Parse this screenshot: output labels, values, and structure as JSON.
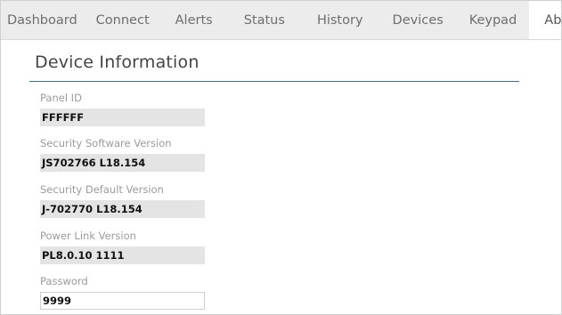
{
  "tabs": [
    {
      "label": "Dashboard",
      "active": false
    },
    {
      "label": "Connect",
      "active": false
    },
    {
      "label": "Alerts",
      "active": false
    },
    {
      "label": "Status",
      "active": false
    },
    {
      "label": "History",
      "active": false
    },
    {
      "label": "Devices",
      "active": false
    },
    {
      "label": "Keypad",
      "active": false
    },
    {
      "label": "About",
      "active": true
    }
  ],
  "section": {
    "title": "Device Information"
  },
  "fields": {
    "panel_id": {
      "label": "Panel ID",
      "value": "FFFFFF"
    },
    "security_software_version": {
      "label": "Security Software Version",
      "value": "JS702766 L18.154"
    },
    "security_default_version": {
      "label": "Security Default Version",
      "value": "J-702770 L18.154"
    },
    "power_link_version": {
      "label": "Power Link Version",
      "value": "PL8.0.10 1111"
    },
    "password": {
      "label": "Password",
      "value": "9999"
    }
  },
  "colors": {
    "accent_underline": "#3e6f96",
    "tabbar_bg": "#ececec",
    "readonly_field_bg": "#e4e4e4"
  }
}
